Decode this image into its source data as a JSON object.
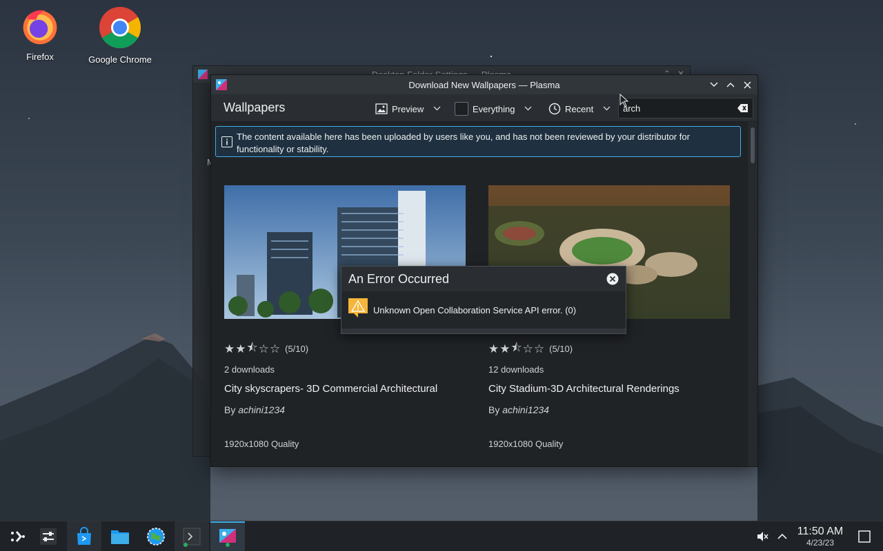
{
  "desktop": {
    "icons": [
      {
        "label": "Firefox"
      },
      {
        "label": "Google Chrome"
      }
    ]
  },
  "background_window": {
    "title": "Desktop Folder Settings — Plasma",
    "side_letter": "M"
  },
  "window": {
    "title": "Download New Wallpapers — Plasma",
    "heading": "Wallpapers",
    "view_mode": "Preview",
    "filter": "Everything",
    "sort": "Recent",
    "search_value": "arch",
    "notice": "The content available here has been uploaded by users like you, and has not been reviewed by your distributor for functionality or stability."
  },
  "cards": [
    {
      "rating_text": "(5/10)",
      "rating": 0.5,
      "downloads": "2 downloads",
      "name": "City skyscrapers- 3D Commercial Architectural",
      "by_prefix": "By",
      "author": "achini1234",
      "quality": "1920x1080 Quality"
    },
    {
      "rating_text": "(5/10)",
      "rating": 0.5,
      "downloads": "12 downloads",
      "name": "City Stadium-3D Architectural Renderings",
      "by_prefix": "By",
      "author": "achini1234",
      "quality": "1920x1080 Quality"
    }
  ],
  "error_dialog": {
    "title": "An Error Occurred",
    "message": "Unknown Open Collaboration Service API error. (0)"
  },
  "taskbar": {
    "time": "11:50 AM",
    "date": "4/23/23"
  },
  "colors": {
    "accent": "#3daee9",
    "warning": "#f6b63b"
  }
}
